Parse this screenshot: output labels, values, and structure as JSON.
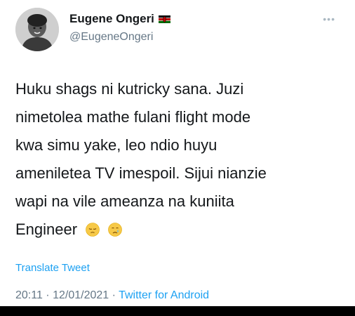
{
  "user": {
    "display_name": "Eugene Ongeri",
    "handle": "@EugeneOngeri",
    "flag_icon": "kenya-flag-icon"
  },
  "tweet": {
    "lines": [
      "Huku shags ni kutricky sana.  Juzi",
      "nimetolea mathe fulani flight mode",
      "kwa simu yake,  leo ndio huyu",
      "ameniletea TV imespoil. Sijui nianzie",
      "wapi na vile ameanza na kuniita",
      "Engineer"
    ],
    "emojis": [
      "pensive-face-icon",
      "crying-face-icon"
    ],
    "translate_label": "Translate Tweet"
  },
  "meta": {
    "time": "20:11",
    "separator1": " · ",
    "date": "12/01/2021",
    "separator2": " · ",
    "source": "Twitter for Android"
  },
  "colors": {
    "link": "#1da1f2",
    "secondary": "#657786",
    "text": "#14171a"
  }
}
